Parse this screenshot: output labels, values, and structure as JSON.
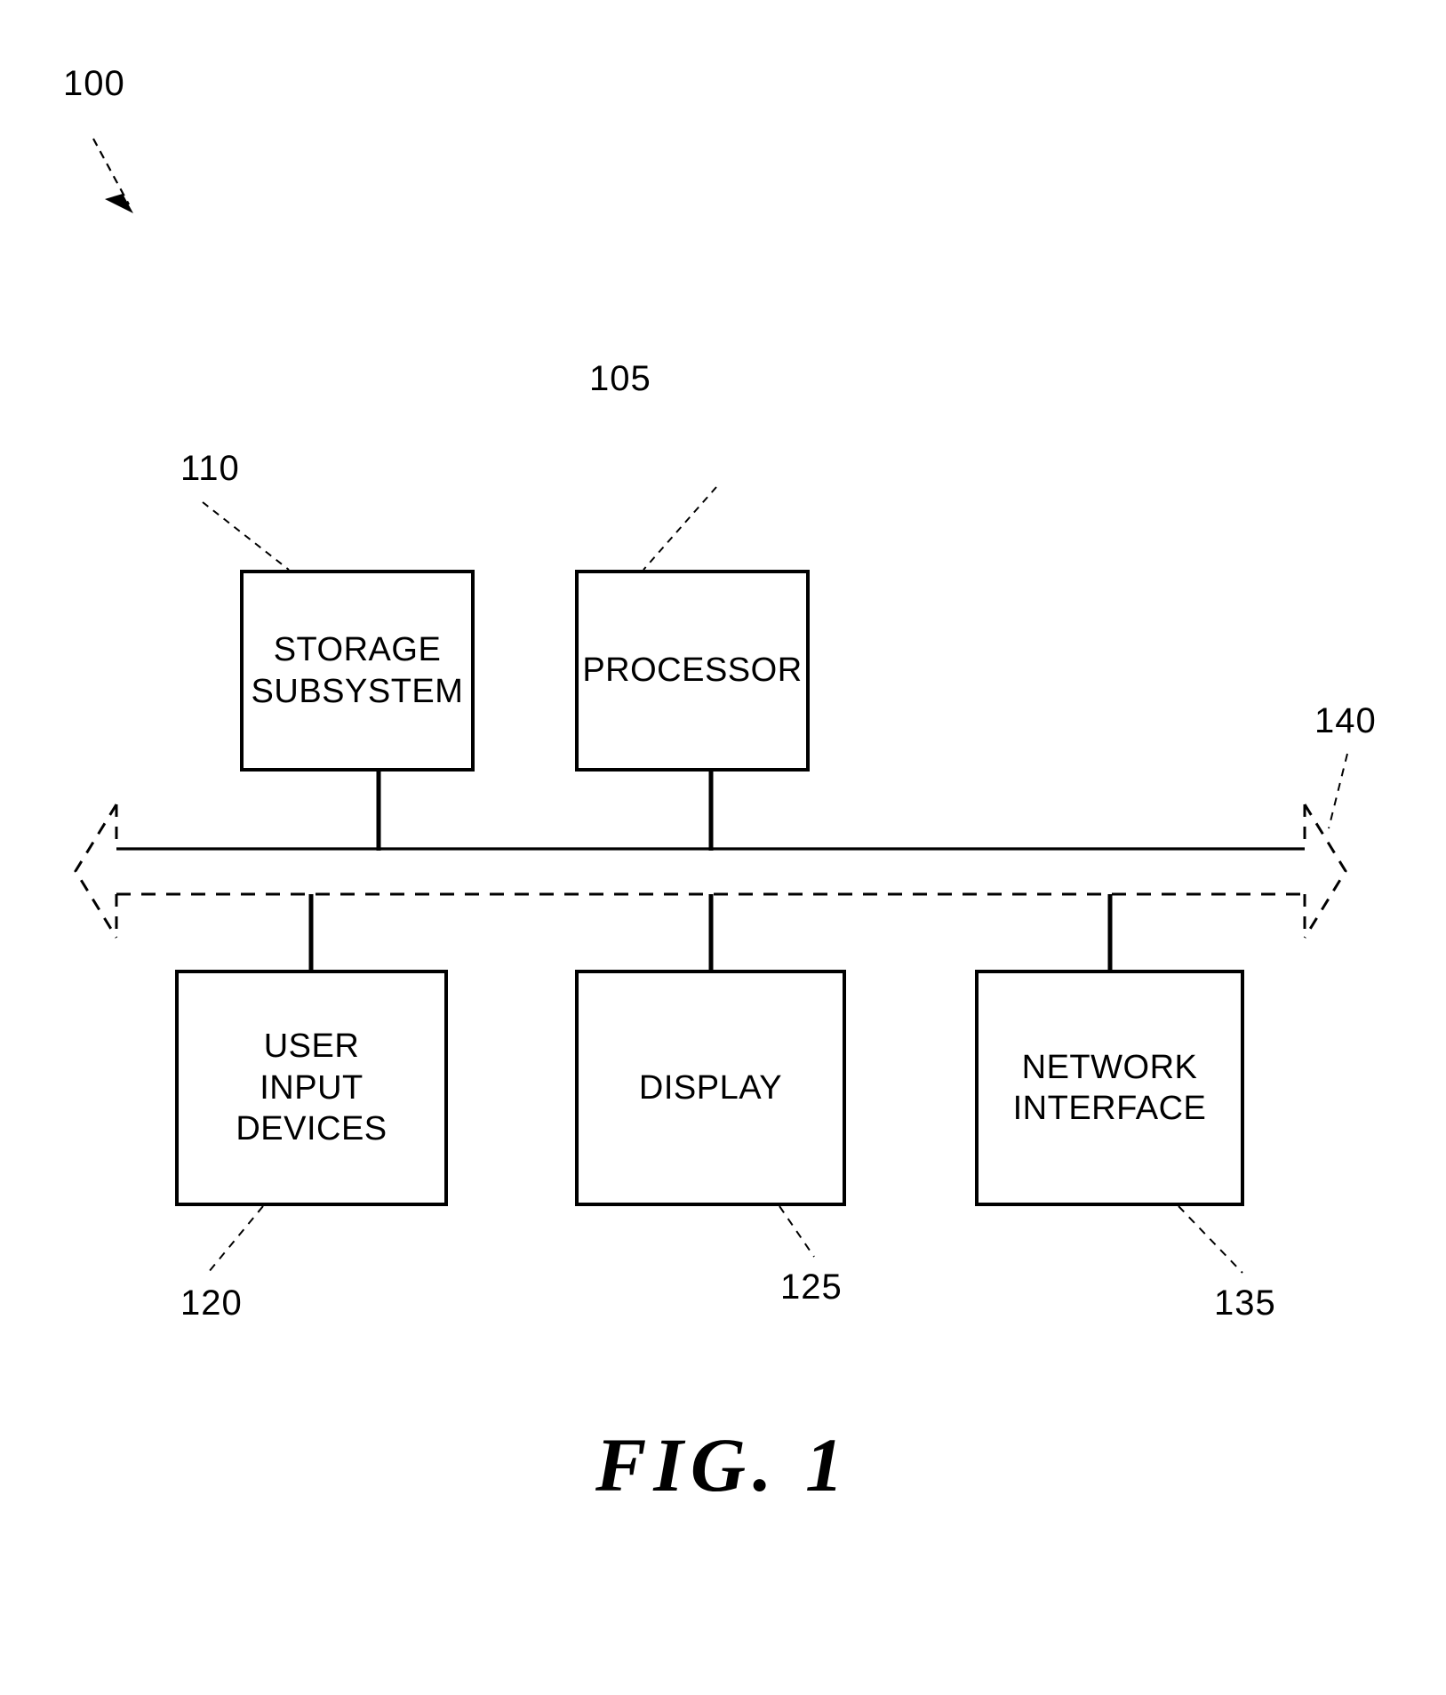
{
  "figure": {
    "caption": "FIG. 1",
    "system_ref": "100"
  },
  "blocks": [
    {
      "id": "storage-subsystem",
      "ref": "110",
      "lines": [
        "STORAGE",
        "SUBSYSTEM"
      ]
    },
    {
      "id": "processor",
      "ref": "105",
      "lines": [
        "PROCESSOR"
      ]
    },
    {
      "id": "user-input-devices",
      "ref": "120",
      "lines": [
        "USER",
        "INPUT",
        "DEVICES"
      ]
    },
    {
      "id": "display",
      "ref": "125",
      "lines": [
        "DISPLAY"
      ]
    },
    {
      "id": "network-interface",
      "ref": "135",
      "lines": [
        "NETWORK",
        "INTERFACE"
      ]
    }
  ],
  "bus": {
    "id": "bus",
    "ref": "140"
  },
  "colors": {
    "stroke": "#000000",
    "background": "#ffffff"
  }
}
